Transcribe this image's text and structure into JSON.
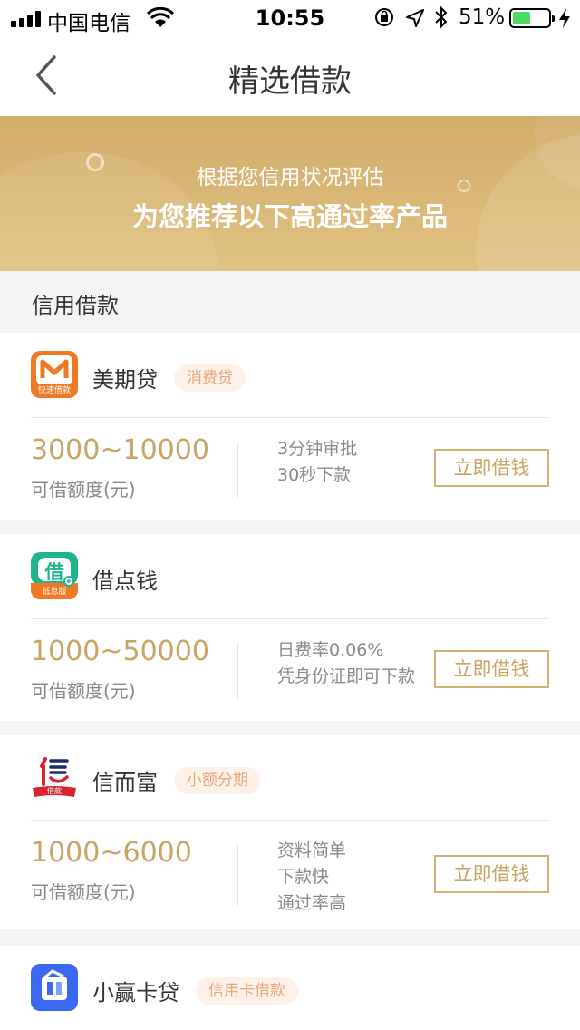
{
  "status_bar": {
    "carrier": "中国电信",
    "time": "10:55",
    "battery_percent": "51%",
    "battery_level": 0.51,
    "icons": [
      "signal-icon",
      "wifi-icon",
      "orientation-lock-icon",
      "location-icon",
      "bluetooth-icon",
      "battery-icon",
      "charging-icon"
    ]
  },
  "nav": {
    "title": "精选借款",
    "back_icon": "chevron-left-icon"
  },
  "banner": {
    "line1": "根据您信用状况评估",
    "line2": "为您推荐以下高通过率产品"
  },
  "section": {
    "title": "信用借款"
  },
  "products": [
    {
      "name": "美期贷",
      "tag": "消费贷",
      "logo_text": "快速借款",
      "amount_range": "3000~10000",
      "amount_label": "可借额度(元)",
      "features": [
        "3分钟审批",
        "30秒下款"
      ],
      "button_label": "立即借钱"
    },
    {
      "name": "借点钱",
      "tag": "",
      "logo_char": "借",
      "logo_text": "低息版",
      "amount_range": "1000~50000",
      "amount_label": "可借额度(元)",
      "features": [
        "日费率0.06%",
        "凭身份证即可下款"
      ],
      "button_label": "立即借钱"
    },
    {
      "name": "信而富",
      "tag": "小额分期",
      "logo_text": "借款",
      "amount_range": "1000~6000",
      "amount_label": "可借额度(元)",
      "features": [
        "资料简单",
        "下款快",
        "通过率高"
      ],
      "button_label": "立即借钱"
    },
    {
      "name": "小赢卡贷",
      "tag": "信用卡借款"
    }
  ],
  "colors": {
    "gold": "#c9a464",
    "banner_top": "#d3ad6c",
    "banner_bottom": "#e0c182",
    "tag_text": "#eba57c",
    "tag_bg": "#fdf1ea",
    "logo_orange": "#f07a24",
    "logo_green": "#1fb48c",
    "logo_red": "#d9232d",
    "logo_blue": "#3a68f0"
  }
}
